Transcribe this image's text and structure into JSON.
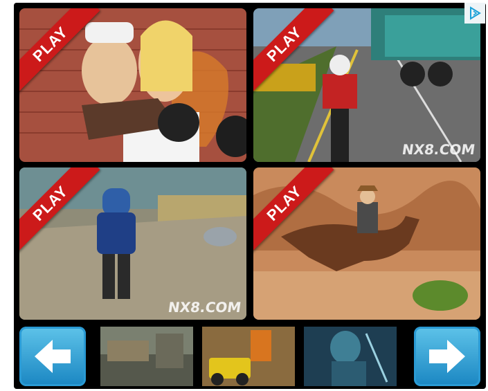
{
  "tiles": [
    {
      "play": "PLAY",
      "watermark": ""
    },
    {
      "play": "PLAY",
      "watermark": "NX8.COM"
    },
    {
      "play": "PLAY",
      "watermark": "NX8.COM"
    },
    {
      "play": "PLAY",
      "watermark": ""
    }
  ],
  "nav": {
    "prev_icon": "left-arrow-icon",
    "next_icon": "right-arrow-icon"
  },
  "ad_icon": "adchoices-icon",
  "colors": {
    "ribbon": "#cc1a1a",
    "nav_button": "#2a9ad4",
    "frame": "#000000"
  }
}
